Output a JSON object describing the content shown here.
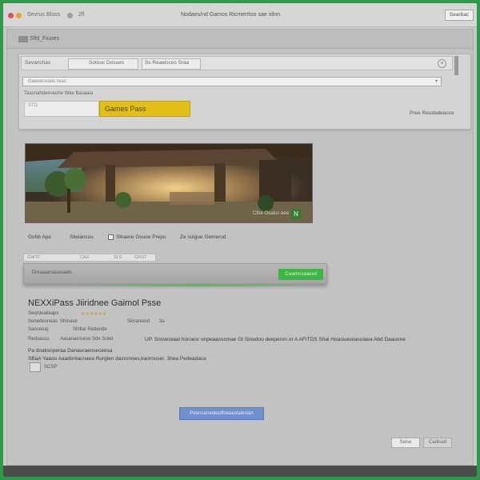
{
  "topbar": {
    "items": [
      "Sevrus",
      "Bloss",
      "2fl"
    ],
    "title": "Nodaes/nd Gamos Ricmerrtoo sae xilnn",
    "right_button": "Searbac",
    "colors": {
      "red": "#d9534f",
      "orange": "#e6a23c",
      "gray": "#9e9e9e"
    }
  },
  "window": {
    "title": "Slfd_Fiuoes",
    "panel": {
      "tabs": [
        "Sevanchas",
        "Sotouc Dosues",
        "Ss Reaeisces Sraa"
      ],
      "close_icon": "close-icon",
      "search_placeholder": "Gaeeeceaeu reas",
      "breadcrumb": "Taasnahdeeveohe Wae Basaaia",
      "filter_value": "STD",
      "primary_button": "Games Pass",
      "side_link": "Pree Reudadeacce"
    },
    "hero": {
      "caption": "Cthe Ooalus  eee",
      "badge": "N"
    },
    "options": [
      "Gohb Ape",
      "Stwiancos",
      "Slnaere Gsuoe Prepo",
      "Ze sulgue Gemerud"
    ],
    "progress": {
      "tabs": [
        "GWTF",
        "CAX",
        "SLS",
        "GRST"
      ],
      "label": "Dnnaaarsasasaats",
      "green_button": "Cwamnsaaesd"
    },
    "game": {
      "title": "NEXXiPass Jiiridnee Gaimol Psse",
      "meta_rows": [
        {
          "k": "Seqrdealiaaps",
          "v": "★★★★★★"
        },
        {
          "k": "Senedeoneas",
          "v": "Shinase"
        },
        {
          "k": "Saoceoa)",
          "v": "Shillar  Rederide"
        },
        {
          "k": "Redsauss",
          "v": "Aasaraerisese   Sde  Sotet"
        }
      ],
      "center_items": [
        "Skiraniand",
        "3a"
      ],
      "long_line": "UP. Sriowooaal horoeor onpeaaoscmae Gt Sinedoo deeperon or A AFITDS  Shai Hoaouaseasuiaea Abd Daauone",
      "desc_lines": [
        "Pa doaksnperaa Danauraenseceesa",
        "SBaA Yaaoo Aaadonlacnaea Rurglen dacronoes,kaorouser. 3hea Pedeadaca"
      ],
      "thumb_label": "SCSP"
    },
    "primary_action": "Peenoanedesdfoeaeolaiestan",
    "ok_label": "Selse",
    "cancel_label": "Cadisad"
  }
}
